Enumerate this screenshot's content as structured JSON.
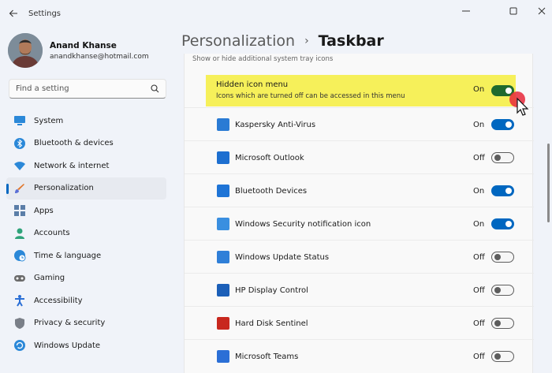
{
  "window": {
    "title": "Settings"
  },
  "profile": {
    "name": "Anand Khanse",
    "email": "anandkhanse@hotmail.com"
  },
  "search": {
    "placeholder": "Find a setting"
  },
  "nav": [
    {
      "label": "System",
      "icon": "monitor-icon"
    },
    {
      "label": "Bluetooth & devices",
      "icon": "bluetooth-icon"
    },
    {
      "label": "Network & internet",
      "icon": "wifi-icon"
    },
    {
      "label": "Personalization",
      "icon": "brush-icon",
      "active": true
    },
    {
      "label": "Apps",
      "icon": "apps-icon"
    },
    {
      "label": "Accounts",
      "icon": "person-icon"
    },
    {
      "label": "Time & language",
      "icon": "globe-clock-icon"
    },
    {
      "label": "Gaming",
      "icon": "gamepad-icon"
    },
    {
      "label": "Accessibility",
      "icon": "accessibility-icon"
    },
    {
      "label": "Privacy & security",
      "icon": "shield-icon"
    },
    {
      "label": "Windows Update",
      "icon": "update-icon"
    }
  ],
  "breadcrumb": {
    "parent": "Personalization",
    "current": "Taskbar"
  },
  "section": {
    "subtitle": "Show or hide additional system tray icons"
  },
  "hidden_menu": {
    "title": "Hidden icon menu",
    "description": "Icons which are turned off can be accessed in this menu",
    "state": "On"
  },
  "items": [
    {
      "name": "Kaspersky Anti-Virus",
      "state": "On",
      "icon": "kaspersky-icon",
      "color": "#2a7bd4"
    },
    {
      "name": "Microsoft Outlook",
      "state": "Off",
      "icon": "outlook-icon",
      "color": "#1d6fd0"
    },
    {
      "name": "Bluetooth Devices",
      "state": "On",
      "icon": "bluetooth-icon",
      "color": "#1e74d6"
    },
    {
      "name": "Windows Security notification icon",
      "state": "On",
      "icon": "security-icon",
      "color": "#3a8fe0"
    },
    {
      "name": "Windows Update Status",
      "state": "Off",
      "icon": "update-icon",
      "color": "#2f7fd8"
    },
    {
      "name": "HP Display Control",
      "state": "Off",
      "icon": "hp-display-icon",
      "color": "#1b5fb8"
    },
    {
      "name": "Hard Disk Sentinel",
      "state": "Off",
      "icon": "disk-sentinel-icon",
      "color": "#c8281e"
    },
    {
      "name": "Microsoft Teams",
      "state": "Off",
      "icon": "teams-icon",
      "color": "#2b6fd6"
    }
  ],
  "colors": {
    "accent": "#0067c0",
    "highlight": "#f6f05a",
    "toggle_green": "#1f6a2e"
  }
}
